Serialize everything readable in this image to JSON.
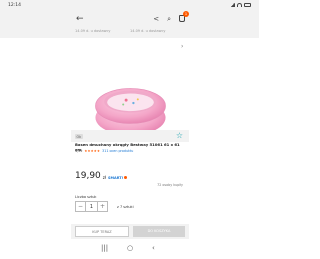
{
  "status_bar": {
    "time": "12:14"
  },
  "top_bar": {
    "back_glyph": "←",
    "share_glyph": "<",
    "search_glyph": "⌕",
    "cart_count": "1"
  },
  "delivery": {
    "left": "14.09 d. u dostawcy",
    "right": "14.09 d. u dostawcy"
  },
  "gallery": {
    "more_glyph": "›"
  },
  "product": {
    "title": "Basen dmuchany okrągły Bestway 51061 61 x 61 cm",
    "rating_value": "4,59",
    "stars": "★★★★★",
    "reviews": "311 ocen produktu",
    "badge": "Ok",
    "price_value": "19,90",
    "price_currency": "zł",
    "smart_label": "SMART!",
    "buyers": "72 osoby kupiły"
  },
  "quantity": {
    "label": "Liczba sztuk",
    "value": "1",
    "minus_glyph": "−",
    "plus_glyph": "+",
    "stock_text": "z 7 sztuki"
  },
  "actions": {
    "buy_now": "KUP TERAZ",
    "add_to_cart": "DO KOSZYKA"
  },
  "nav": {
    "recents": "|||",
    "home": "○",
    "back": "‹"
  },
  "colors": {
    "accent": "#ff5a00",
    "teal": "#14a0ad",
    "pool_pink": "#f4a6c8"
  }
}
